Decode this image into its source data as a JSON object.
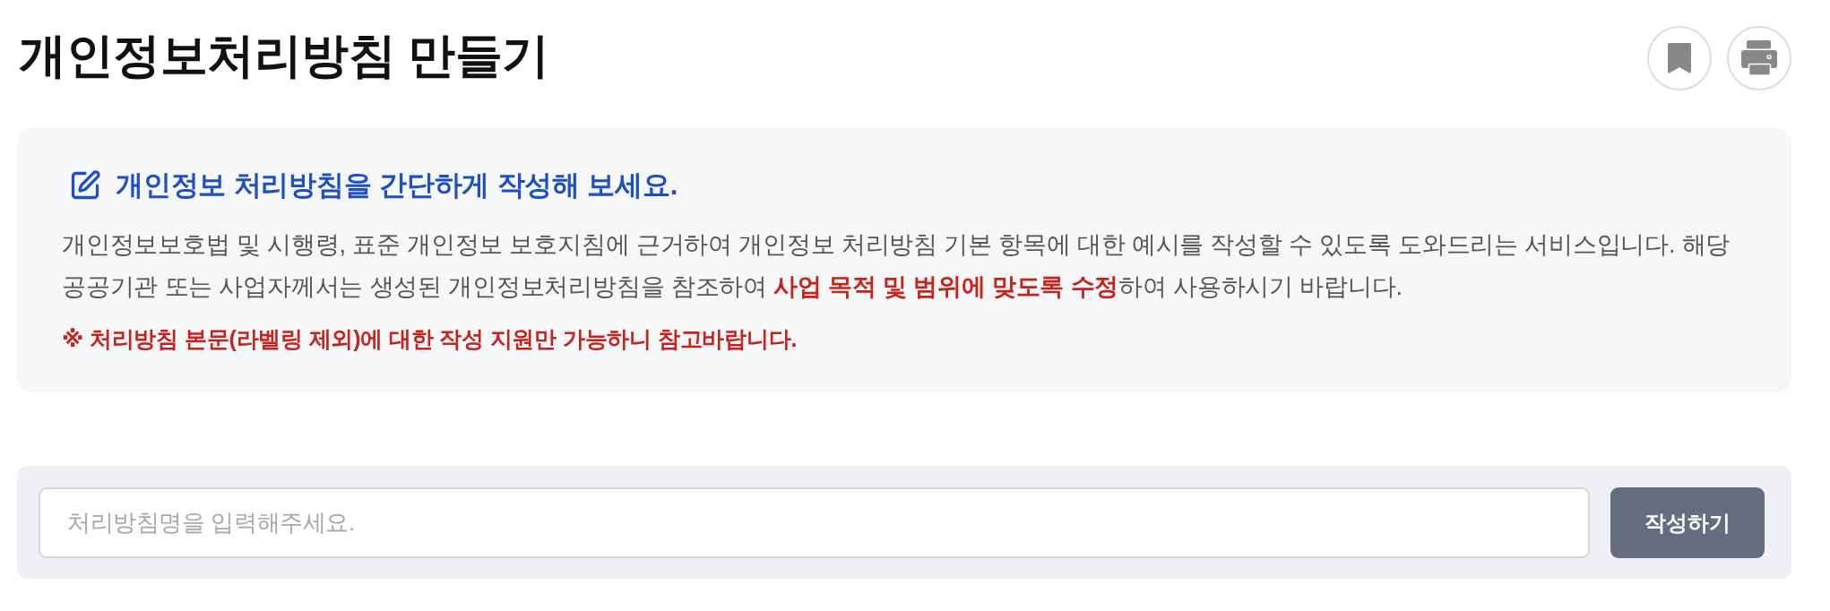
{
  "page": {
    "title": "개인정보처리방침 만들기"
  },
  "intro": {
    "heading": "개인정보 처리방침을 간단하게 작성해 보세요.",
    "description": "개인정보보호법 및 시행령, 표준 개인정보 보호지침에 근거하여 개인정보 처리방침 기본 항목에 대한 예시를 작성할 수 있도록 도와드리는 서비스입니다. 해당 공공기관 또는 사업자께서는 생성된 개인정보처리방침을 참조하여 **사업 목적 및 범위에 맞도록 수정**하여 사용하시기 바랍니다.",
    "notice": "※ 처리방침 본문(라벨링 제외)에 대한 작성 지원만 가능하니 참고바랍니다."
  },
  "form": {
    "placeholder": "처리방침명을 입력해주세요.",
    "submit_button": "작성하기"
  }
}
